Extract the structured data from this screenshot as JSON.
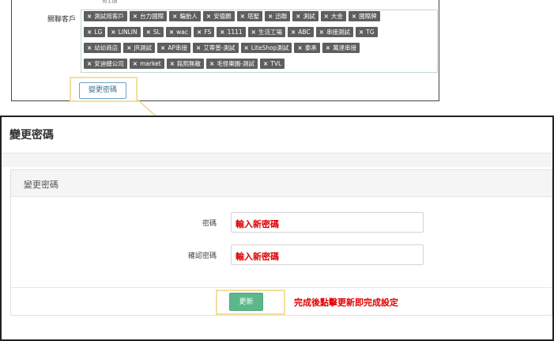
{
  "top": {
    "tiny_text": "70.1-08",
    "customer_label": "關聯客戶",
    "tags": [
      "測試用客戶",
      "台力國際",
      "輪胎人",
      "安德願",
      "塔聖",
      "迅聯",
      "測試",
      "大金",
      "國際牌",
      "LG",
      "LINLIN",
      "SL",
      "wac",
      "FS",
      "1111",
      "生活工場",
      "ABC",
      "串接測試",
      "TG",
      "幼幼商店",
      "JR測試",
      "AP串接",
      "艾蒂普-測試",
      "LiteShop測試",
      "泰承",
      "萬達串接",
      "安迪總公司",
      "market",
      "銘熙無敵",
      "毛怪樂園-測試",
      "TVL"
    ],
    "change_password_button": "變更密碼"
  },
  "dialog": {
    "title": "變更密碼",
    "panel_title": "變更密碼",
    "password_label": "密碼",
    "password_placeholder": "輸入新密碼",
    "confirm_label": "確認密碼",
    "confirm_placeholder": "輸入新密碼",
    "update_button": "更新",
    "annotation": "完成後點擊更新即完成設定"
  },
  "colors": {
    "highlight": "#f3df9c",
    "tag_bg": "#5e5e5e",
    "update_green": "#5cb88a",
    "annotation_red": "#e00000"
  }
}
